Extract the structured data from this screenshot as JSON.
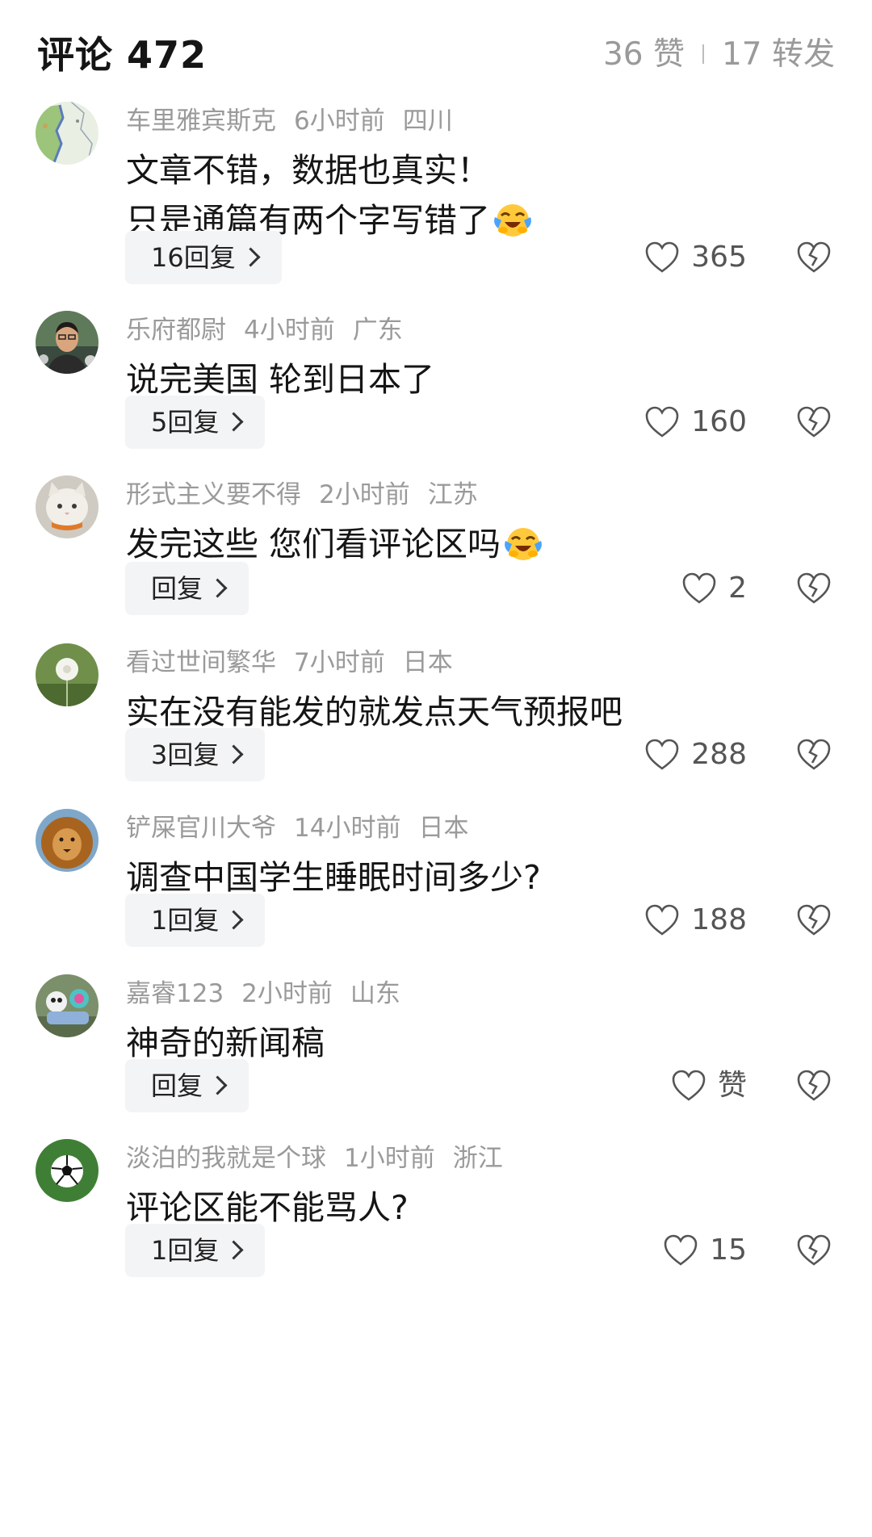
{
  "header": {
    "title": "评论 472",
    "likes": "36 赞",
    "shares": "17 转发"
  },
  "comments": [
    {
      "user": "车里雅宾斯克",
      "time": "6小时前",
      "location": "四川",
      "lines": [
        "文章不错，数据也真实！",
        "只是通篇有两个字写错了"
      ],
      "emoji": "laughing-crying",
      "reply_label": "16回复",
      "likes": "365"
    },
    {
      "user": "乐府都尉",
      "time": "4小时前",
      "location": "广东",
      "lines": [
        "说完美国 轮到日本了"
      ],
      "emoji": "",
      "reply_label": "5回复",
      "likes": "160"
    },
    {
      "user": "形式主义要不得",
      "time": "2小时前",
      "location": "江苏",
      "lines": [
        "发完这些 您们看评论区吗"
      ],
      "emoji": "laughing-crying",
      "reply_label": "回复",
      "likes": "2"
    },
    {
      "user": "看过世间繁华",
      "time": "7小时前",
      "location": "日本",
      "lines": [
        "实在没有能发的就发点天气预报吧"
      ],
      "emoji": "",
      "reply_label": "3回复",
      "likes": "288"
    },
    {
      "user": "铲屎官川大爷",
      "time": "14小时前",
      "location": "日本",
      "lines": [
        "调查中国学生睡眠时间多少?"
      ],
      "emoji": "",
      "reply_label": "1回复",
      "likes": "188"
    },
    {
      "user": "嘉睿123",
      "time": "2小时前",
      "location": "山东",
      "lines": [
        "神奇的新闻稿"
      ],
      "emoji": "",
      "reply_label": "回复",
      "likes": "赞"
    },
    {
      "user": "淡泊的我就是个球",
      "time": "1小时前",
      "location": "浙江",
      "lines": [
        "评论区能不能骂人?"
      ],
      "emoji": "",
      "reply_label": "1回复",
      "likes": "15"
    }
  ],
  "icons": {
    "like": "heart-outline-icon",
    "dislike": "broken-heart-icon",
    "reply_arrow": "chevron-right-icon"
  },
  "colors": {
    "secondary_text": "#9a9a9a",
    "reply_bg": "#f3f4f6"
  }
}
